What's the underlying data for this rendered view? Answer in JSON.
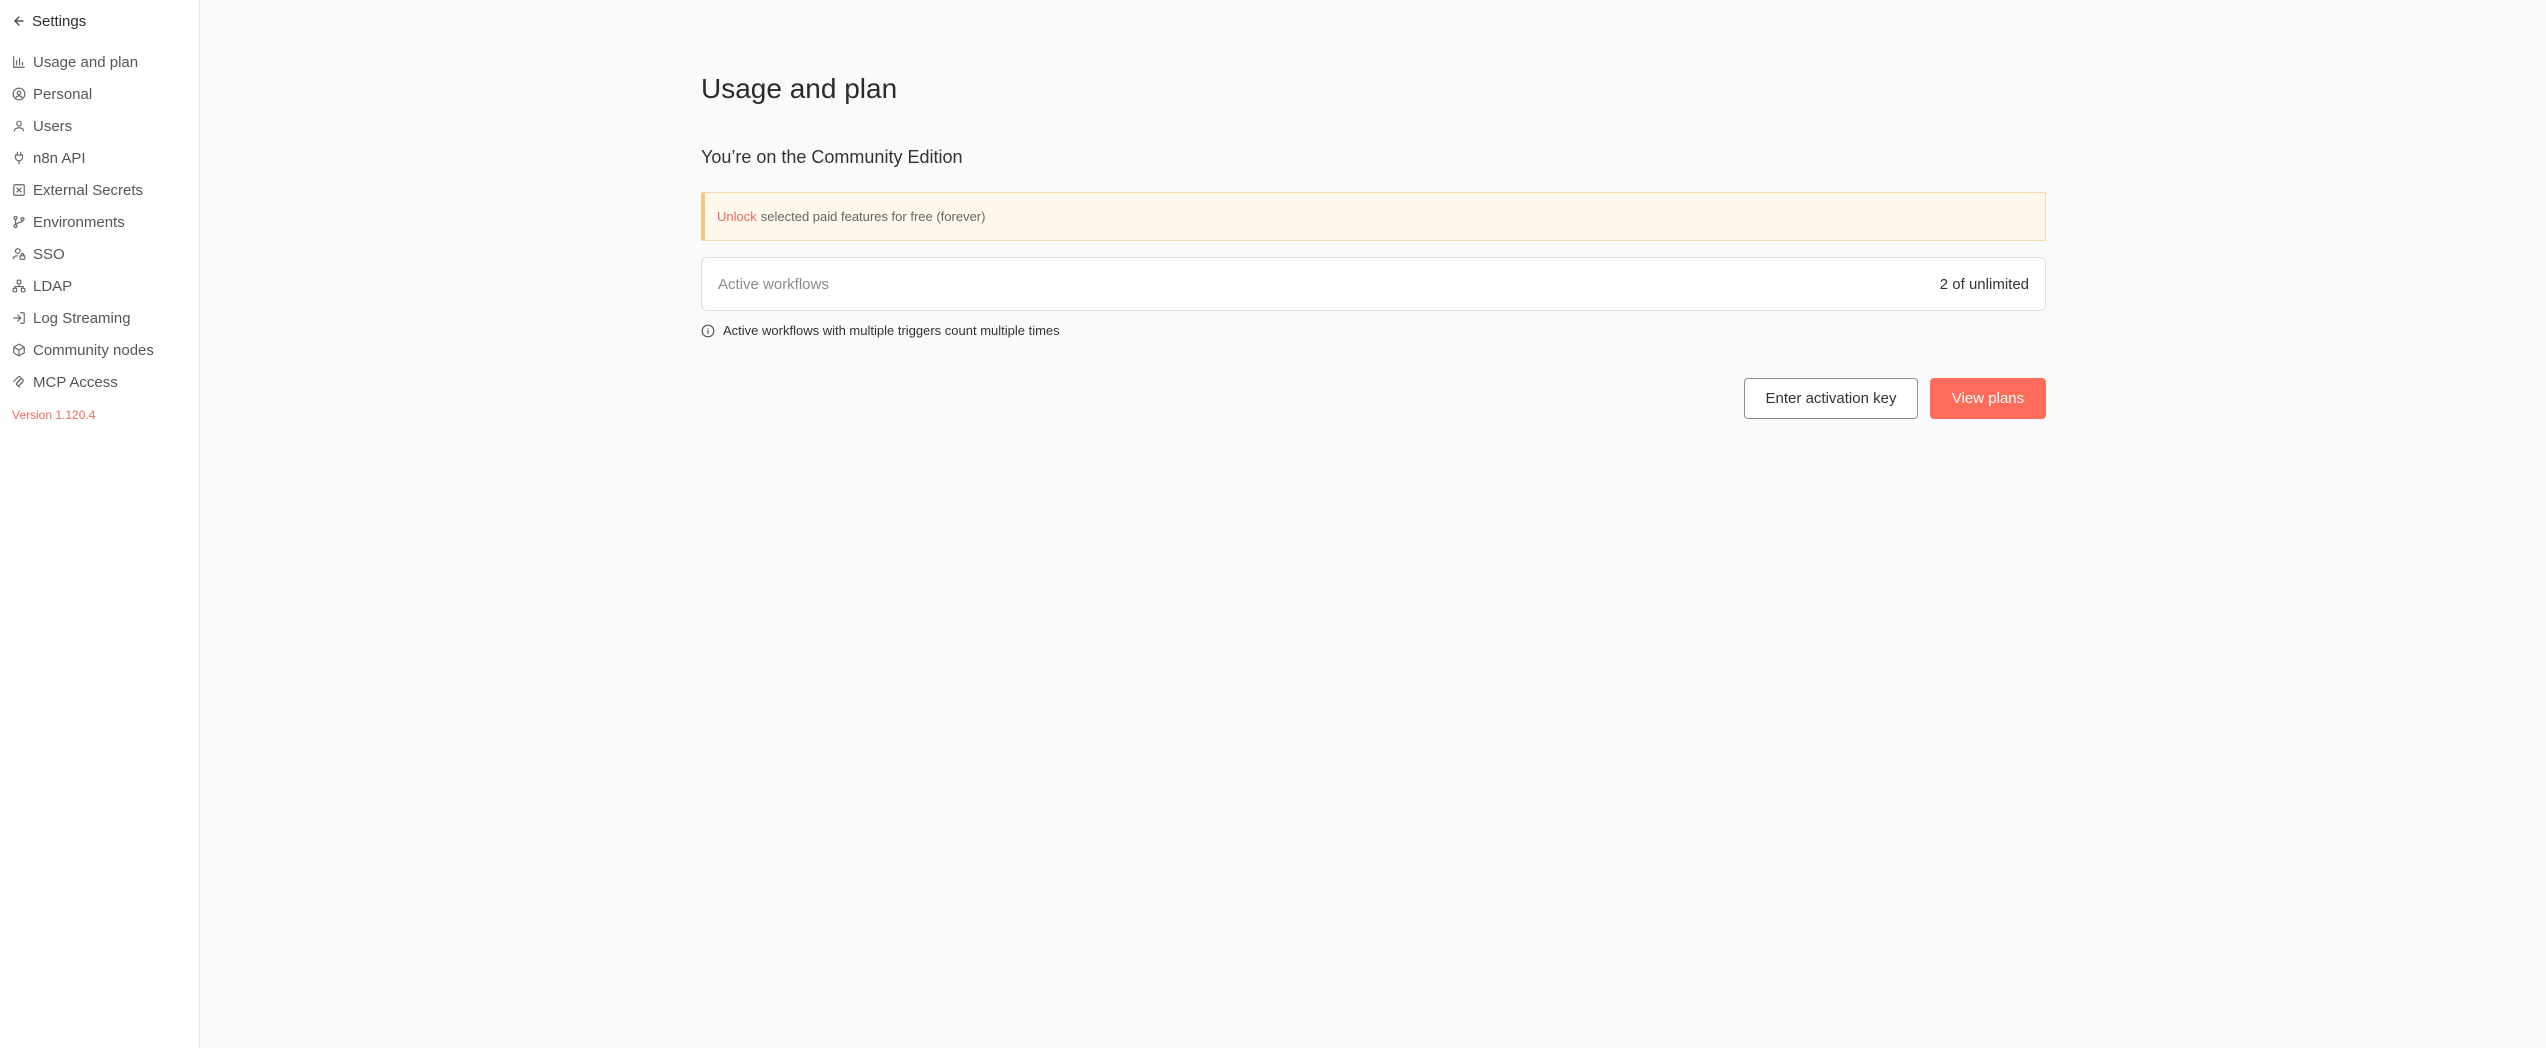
{
  "sidebar": {
    "back_title": "Settings",
    "items": [
      {
        "label": "Usage and plan",
        "icon": "bar-chart-icon"
      },
      {
        "label": "Personal",
        "icon": "user-circle-icon"
      },
      {
        "label": "Users",
        "icon": "user-icon"
      },
      {
        "label": "n8n API",
        "icon": "plug-icon"
      },
      {
        "label": "External Secrets",
        "icon": "square-x-icon"
      },
      {
        "label": "Environments",
        "icon": "git-branch-icon"
      },
      {
        "label": "SSO",
        "icon": "user-lock-icon"
      },
      {
        "label": "LDAP",
        "icon": "network-icon"
      },
      {
        "label": "Log Streaming",
        "icon": "log-in-icon"
      },
      {
        "label": "Community nodes",
        "icon": "box-icon"
      },
      {
        "label": "MCP Access",
        "icon": "mcp-icon"
      }
    ],
    "version": "Version 1.120.4"
  },
  "main": {
    "title": "Usage and plan",
    "edition": "You’re on the Community Edition",
    "callout": {
      "link": "Unlock",
      "text": "selected paid features for free (forever)"
    },
    "usage": {
      "label": "Active workflows",
      "value": "2 of unlimited"
    },
    "note": "Active workflows with multiple triggers count multiple times",
    "buttons": {
      "activation": "Enter activation key",
      "view_plans": "View plans"
    }
  },
  "colors": {
    "accent": "#ff6d5a",
    "version_text": "#ea6a5a",
    "callout_bg": "#fef7ec",
    "callout_border": "#f7c77e"
  }
}
